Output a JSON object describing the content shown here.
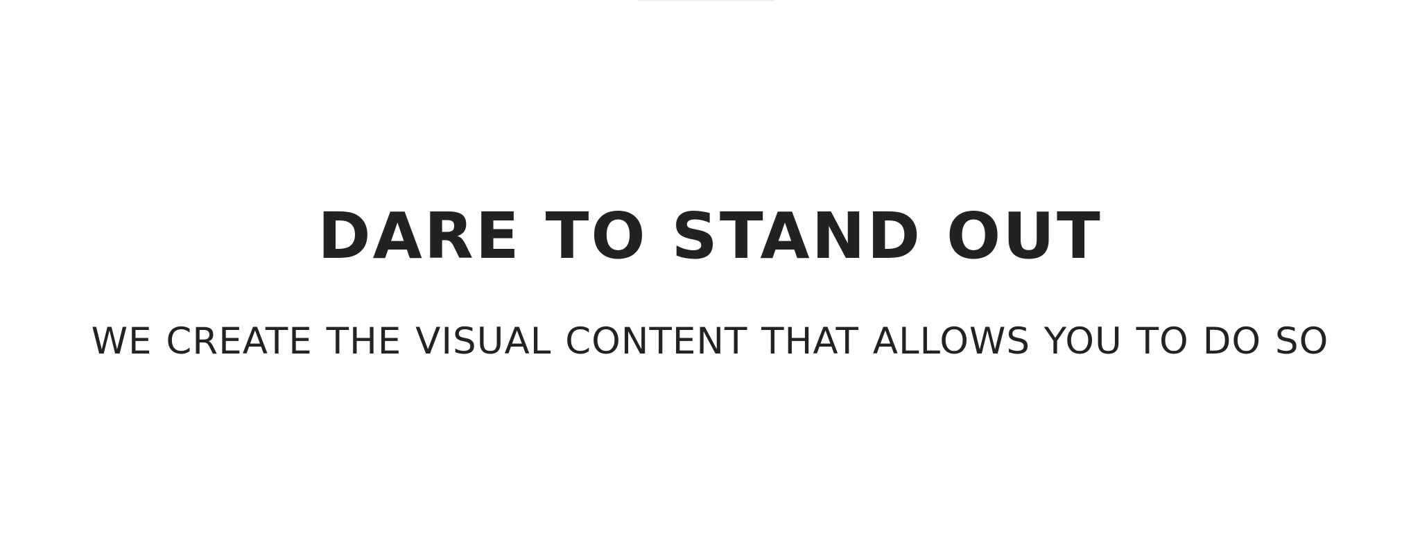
{
  "hero": {
    "title": "DARE TO STAND OUT",
    "subtitle": "WE CREATE THE VISUAL CONTENT THAT ALLOWS YOU TO DO SO"
  },
  "colors": {
    "background": "#ffffff",
    "text": "#222222",
    "top_rule": "#ececec"
  }
}
